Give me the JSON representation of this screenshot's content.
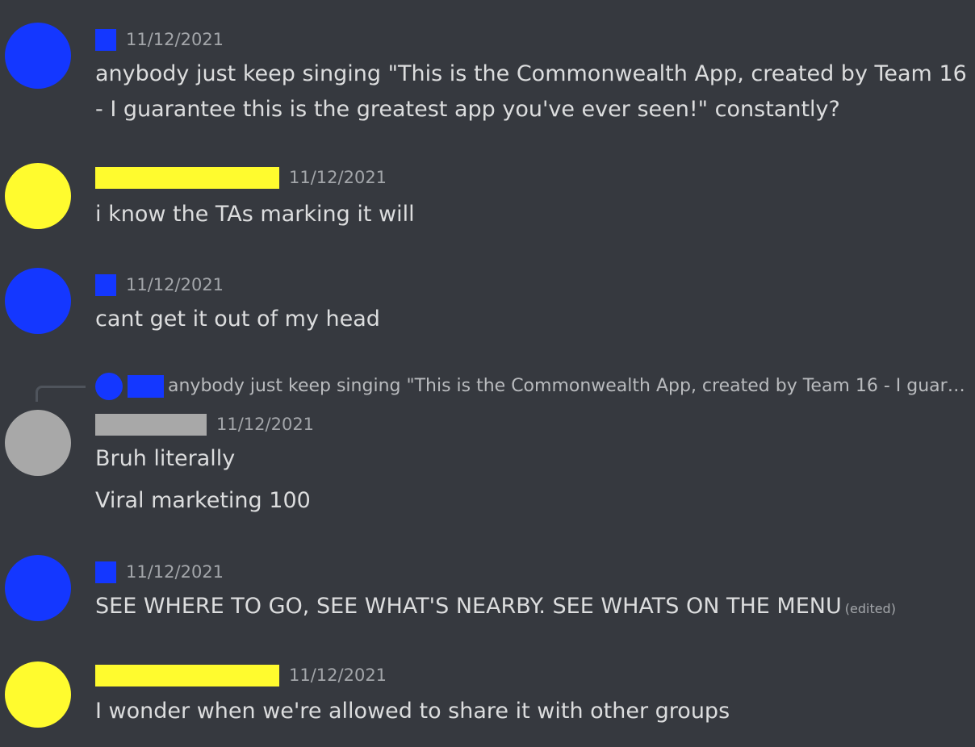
{
  "colors": {
    "background": "#36393f",
    "user_blue": "#1437ff",
    "user_yellow": "#fffb2e",
    "user_grey": "#a8a8a8"
  },
  "messages": [
    {
      "timestamp": "11/12/2021",
      "lines": [
        "anybody just keep singing \"This is the Commonwealth App, created by Team 16",
        "- I guarantee this is the greatest app you've ever seen!\" constantly?"
      ]
    },
    {
      "timestamp": "11/12/2021",
      "lines": [
        "i know the TAs marking it will"
      ]
    },
    {
      "timestamp": "11/12/2021",
      "lines": [
        "cant get it out of my head"
      ]
    },
    {
      "reply_preview": "anybody just keep singing \"This is the Commonwealth App, created by Team 16 - I guarantee this is the greatest app you've ever seen!\" constantly?",
      "timestamp": "11/12/2021",
      "lines": [
        "Bruh literally",
        "Viral marketing 100"
      ]
    },
    {
      "timestamp": "11/12/2021",
      "lines": [
        "SEE WHERE TO GO, SEE WHAT'S NEARBY. SEE WHATS ON THE MENU"
      ],
      "edited_label": "(edited)"
    },
    {
      "timestamp": "11/12/2021",
      "lines": [
        "I wonder when we're allowed to share it with other groups"
      ]
    }
  ]
}
